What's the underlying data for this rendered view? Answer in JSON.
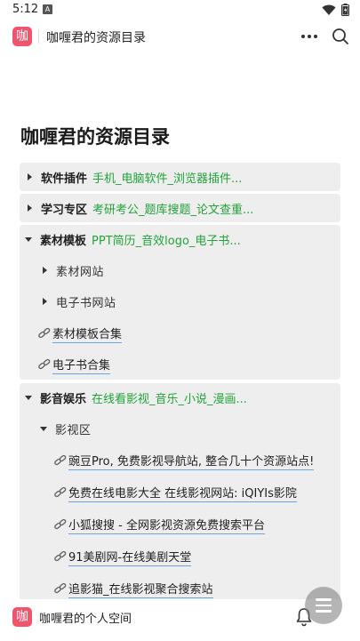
{
  "status": {
    "time": "5:12",
    "notif_badge": "A"
  },
  "appbar": {
    "logo": "咖",
    "title": "咖喱君的资源目录"
  },
  "page": {
    "title": "咖喱君的资源目录"
  },
  "toggles": [
    {
      "label": "软件插件",
      "desc": "手机_电脑软件_浏览器插件..."
    },
    {
      "label": "学习专区",
      "desc": "考研考公_题库搜题_论文查重..."
    },
    {
      "label": "素材模板",
      "desc": "PPT简历_音效logo_电子书..."
    },
    {
      "label": "影音娱乐",
      "desc": "在线看影视_音乐_小说_漫画..."
    }
  ],
  "materials": {
    "subtoggles": [
      "素材网站",
      "电子书网站"
    ],
    "links": [
      "素材模板合集",
      "电子书合集"
    ]
  },
  "media": {
    "subtoggle": "影视区",
    "links": [
      "豌豆Pro, 免费影视导航站, 整合几十个资源站点!",
      "免费在线电影大全 在线影视网站: iQIYIs影院",
      "小狐搜搜 - 全网影视资源免费搜索平台",
      "91美剧网-在线美剧天堂",
      "追影猫_在线影视聚合搜索站"
    ]
  },
  "bottombar": {
    "logo": "咖",
    "title": "咖喱君的个人空间"
  },
  "colors": {
    "accent_green": "#22a33a",
    "link_underline": "#6ba4e6",
    "brand": "#f2546e"
  },
  "icons": [
    "wifi-icon",
    "battery-icon",
    "more-icon",
    "search-icon",
    "link-icon",
    "bell-icon",
    "menu-icon"
  ]
}
